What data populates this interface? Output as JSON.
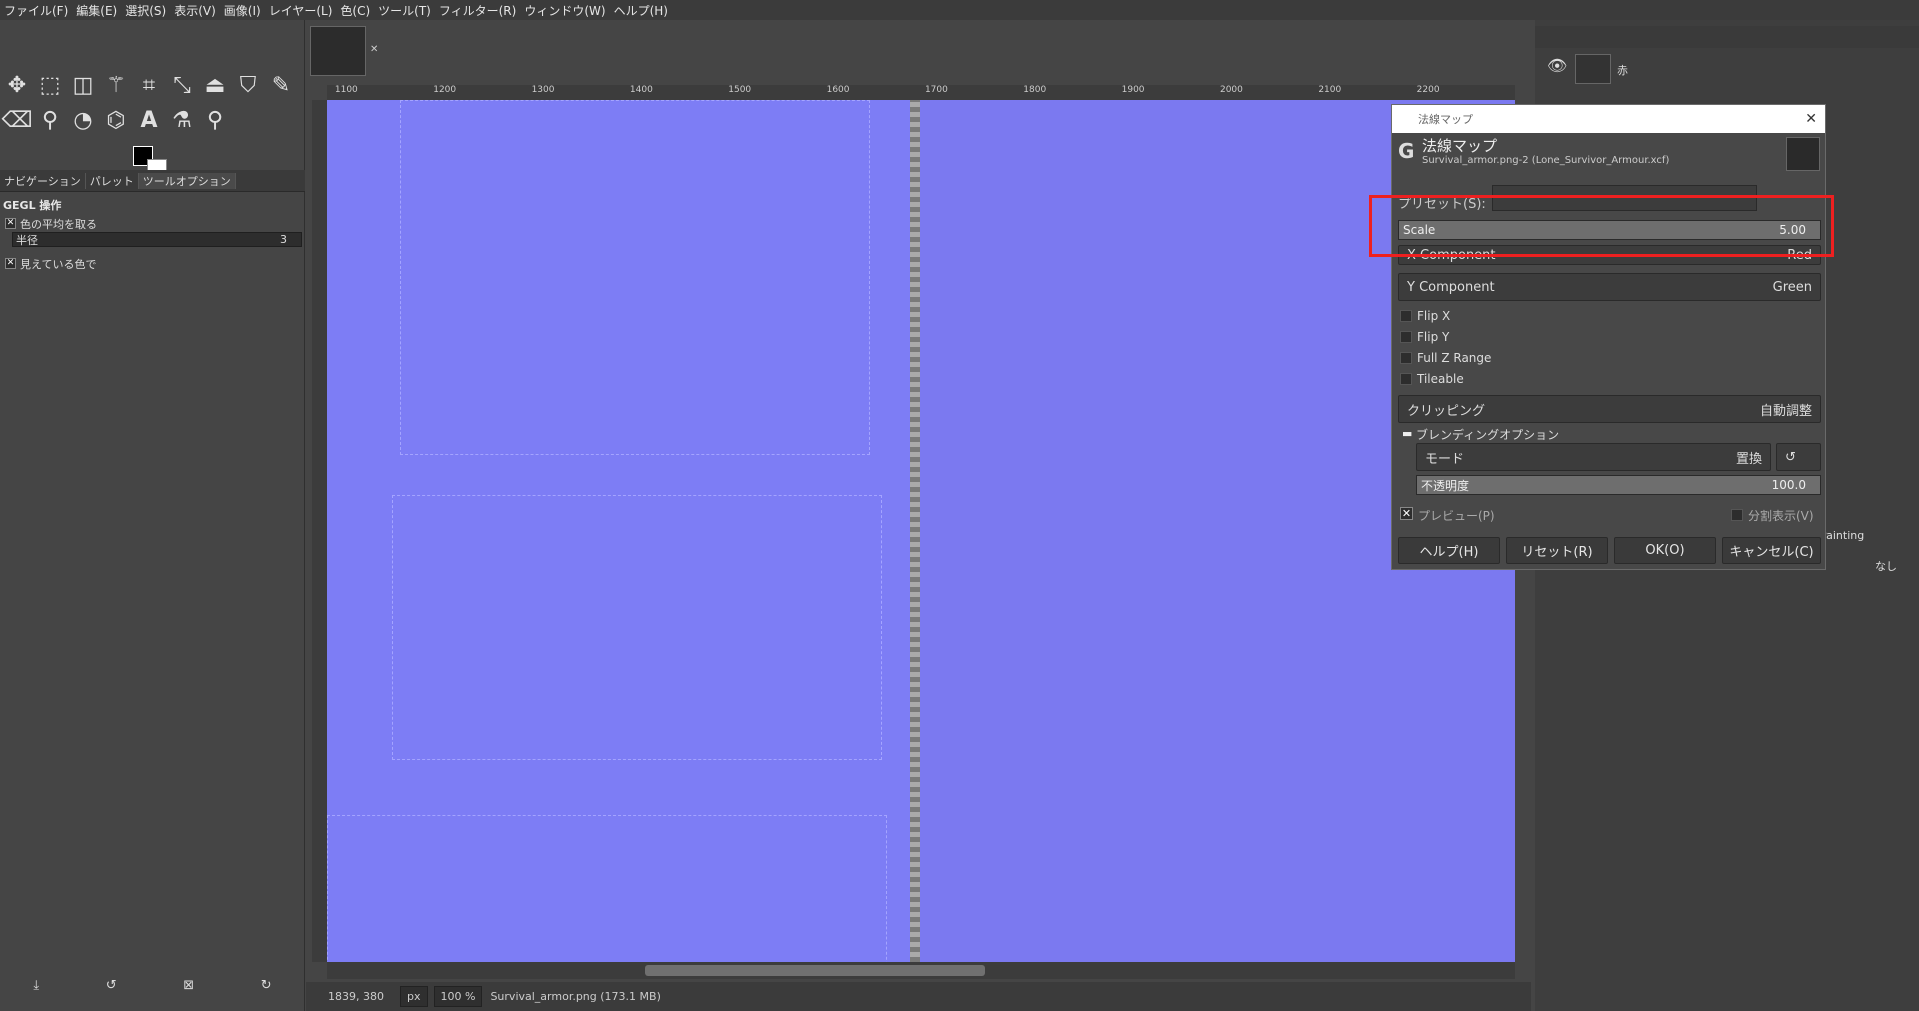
{
  "menu": [
    "ファイル(F)",
    "編集(E)",
    "選択(S)",
    "表示(V)",
    "画像(I)",
    "レイヤー(L)",
    "色(C)",
    "ツール(T)",
    "フィルター(R)",
    "ウィンドウ(W)",
    "ヘルプ(H)"
  ],
  "toolbox": {
    "tabs": [
      "ナビゲーション",
      "パレット",
      "ツールオプション"
    ],
    "options_title": "GEGL 操作",
    "avg_label": "色の平均を取る",
    "radius_label": "半径",
    "radius_value": "3",
    "visible_label": "見えている色で"
  },
  "canvas": {
    "ruler_marks": [
      "1100",
      "1200",
      "1300",
      "1400",
      "1500",
      "1600",
      "1700",
      "1800",
      "1900",
      "2000",
      "2100",
      "2200"
    ]
  },
  "layers": {
    "layer1": "赤"
  },
  "dialog": {
    "window_title": "法線マップ",
    "heading": "法線マップ",
    "subtitle": "Survival_armor.png-2 (Lone_Survivor_Armour.xcf)",
    "preset_label": "プリセット(S):",
    "scale_label": "Scale",
    "scale_value": "5.00",
    "x_component_label": "X Component",
    "x_component_value": "Red",
    "y_component_label": "Y Component",
    "y_component_value": "Green",
    "flip_x": "Flip X",
    "flip_y": "Flip Y",
    "full_z": "Full Z Range",
    "tileable": "Tileable",
    "clipping_label": "クリッピング",
    "clipping_value": "自動調整",
    "blending_label": "ブレンディングオプション",
    "mode_label": "モード",
    "mode_value": "置換",
    "opacity_label": "不透明度",
    "opacity_value": "100.0",
    "preview_label": "プレビュー(P)",
    "split_label": "分割表示(V)",
    "btn_help": "ヘルプ(H)",
    "btn_reset": "リセット(R)",
    "btn_ok": "OK(O)",
    "btn_cancel": "キャンセル(C)"
  },
  "right_panel": {
    "painting_tab": "Painting",
    "none_value": "なし"
  },
  "status": {
    "coords": "1839, 380",
    "unit": "px",
    "zoom": "100 %",
    "file": "Survival_armor.png (173.1 MB)"
  },
  "colors": {
    "highlight": "#ee2020",
    "canvas": "#7d7df5"
  }
}
